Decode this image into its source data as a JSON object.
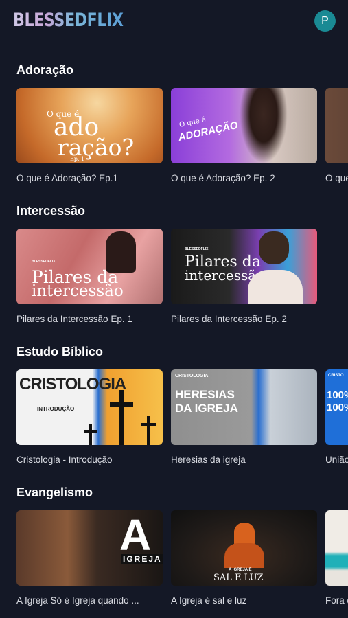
{
  "app": {
    "logo": "BLESSEDFLIX",
    "avatar_initial": "P"
  },
  "colors": {
    "background": "#141826",
    "avatar": "#1a8a94"
  },
  "sections": [
    {
      "title": "Adoração",
      "cards": [
        {
          "title": "O que é Adoração? Ep.1",
          "thumb_line1": "O que é",
          "thumb_line2": "ado",
          "thumb_line3": "ração?",
          "thumb_ep": "Ep. 1"
        },
        {
          "title": "O que é Adoração? Ep. 2",
          "thumb_line1": "O que é",
          "thumb_line2": "ADORAÇÃO"
        },
        {
          "title": "O que"
        }
      ]
    },
    {
      "title": "Intercessão",
      "cards": [
        {
          "title": "Pilares da Intercessão Ep. 1",
          "thumb_brand": "BLESSEDFLIX",
          "thumb_line1": "Pilares da",
          "thumb_line2": "intercessão"
        },
        {
          "title": "Pilares da Intercessão Ep. 2",
          "thumb_brand": "BLESSEDFLIX",
          "thumb_line1": "Pilares da",
          "thumb_line2": "intercessão"
        }
      ]
    },
    {
      "title": "Estudo Bíblico",
      "cards": [
        {
          "title": "Cristologia - Introdução",
          "thumb_line1": "CRISTOLOGIA",
          "thumb_line2": "INTRODUÇÃO"
        },
        {
          "title": "Heresias da igreja",
          "thumb_tag": "CRISTOLOGIA",
          "thumb_line1": "HERESIAS",
          "thumb_line2": "DA IGREJA"
        },
        {
          "title": "União",
          "thumb_tag": "CRISTO",
          "thumb_line1": "100%",
          "thumb_line2": "100%"
        }
      ]
    },
    {
      "title": "Evangelismo",
      "cards": [
        {
          "title": "A Igreja Só é Igreja quando ...",
          "thumb_big": "A",
          "thumb_line1": "IGREJA"
        },
        {
          "title": "A Igreja é sal e luz",
          "thumb_line1": "A IGREJA É",
          "thumb_line2": "SAL E LUZ"
        },
        {
          "title": "Fora d"
        }
      ]
    }
  ]
}
